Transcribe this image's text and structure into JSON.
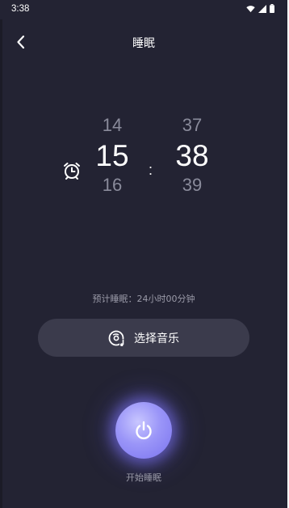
{
  "status_bar": {
    "time": "3:38"
  },
  "header": {
    "title": "睡眠"
  },
  "time_picker": {
    "hour": {
      "prev": "14",
      "current": "15",
      "next": "16"
    },
    "separator": ":",
    "minute": {
      "prev": "37",
      "current": "38",
      "next": "39"
    }
  },
  "estimate_text": "预计睡眠：24小时00分钟",
  "music_button": {
    "label": "选择音乐",
    "icon": "music-disc-icon"
  },
  "start": {
    "label": "开始睡眠",
    "icon": "power-icon"
  },
  "colors": {
    "background": "#232333",
    "accent": "#8f88f6",
    "muted_text": "#9a9aa8"
  }
}
